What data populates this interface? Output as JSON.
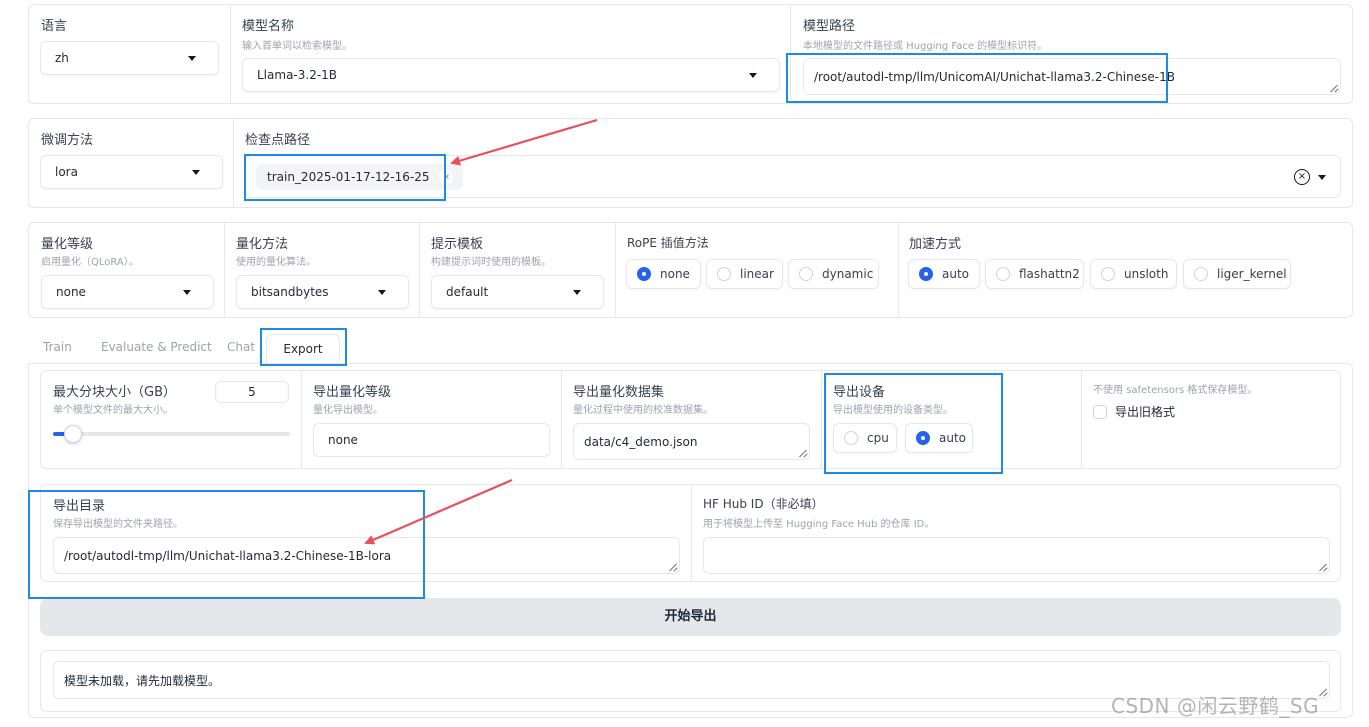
{
  "top": {
    "language": {
      "label": "语言",
      "value": "zh"
    },
    "model_name": {
      "label": "模型名称",
      "info": "输入首单词以检索模型。",
      "value": "Llama-3.2-1B"
    },
    "model_path": {
      "label": "模型路径",
      "info": "本地模型的文件路径或 Hugging Face 的模型标识符。",
      "value": "/root/autodl-tmp/llm/UnicomAI/Unichat-llama3.2-Chinese-1B"
    }
  },
  "finetune": {
    "method": {
      "label": "微调方法",
      "value": "lora"
    },
    "checkpoint": {
      "label": "检查点路径",
      "chip": "train_2025-01-17-12-16-25",
      "chip_remove": "×",
      "clear": "×"
    }
  },
  "quant": {
    "level": {
      "label": "量化等级",
      "info": "启用量化（QLoRA）。",
      "value": "none"
    },
    "method": {
      "label": "量化方法",
      "info": "使用的量化算法。",
      "value": "bitsandbytes"
    },
    "template": {
      "label": "提示模板",
      "info": "构建提示词时使用的模板。",
      "value": "default"
    },
    "rope": {
      "label": "RoPE 插值方法",
      "options": [
        "none",
        "linear",
        "dynamic"
      ],
      "selected": "none"
    },
    "booster": {
      "label": "加速方式",
      "options": [
        "auto",
        "flashattn2",
        "unsloth",
        "liger_kernel"
      ],
      "selected": "auto"
    }
  },
  "tabs": [
    "Train",
    "Evaluate & Predict",
    "Chat",
    "Export"
  ],
  "active_tab": "Export",
  "export": {
    "max_shard": {
      "label": "最大分块大小（GB）",
      "info": "单个模型文件的最大大小。",
      "value": "5",
      "slider_fraction": 0.05
    },
    "quant_bit": {
      "label": "导出量化等级",
      "info": "量化导出模型。",
      "value": "none"
    },
    "quant_dataset": {
      "label": "导出量化数据集",
      "info": "量化过程中使用的校准数据集。",
      "value": "data/c4_demo.json"
    },
    "device": {
      "label": "导出设备",
      "info": "导出模型使用的设备类型。",
      "options": [
        "cpu",
        "auto"
      ],
      "selected": "auto"
    },
    "legacy": {
      "info": "不使用 safetensors 格式保存模型。",
      "label": "导出旧格式",
      "checked": false
    },
    "dir": {
      "label": "导出目录",
      "info": "保存导出模型的文件夹路径。",
      "value": "/root/autodl-tmp/llm/Unichat-llama3.2-Chinese-1B-lora"
    },
    "hub": {
      "label": "HF Hub ID（非必填）",
      "info": "用于将模型上传至 Hugging Face Hub 的仓库 ID。",
      "value": ""
    },
    "button": "开始导出",
    "output": "模型未加载，请先加载模型。"
  },
  "watermark": "CSDN @闲云野鹤_SG",
  "colors": {
    "accent": "#2563eb",
    "highlight": "#1d8ce0",
    "arrow": "#e8505b"
  }
}
